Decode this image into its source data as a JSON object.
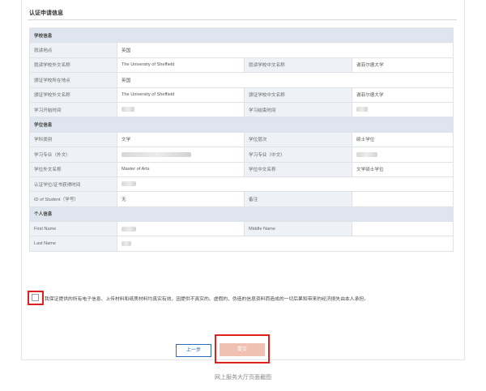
{
  "section_title": "认证申请信息",
  "school_section": {
    "header": "学校信息",
    "rows": [
      {
        "l1": "就读地点",
        "v1": "英国",
        "l2": "",
        "v2": ""
      },
      {
        "l1": "就读学校外文名称",
        "v1": "The University of Sheffield",
        "l2": "就读学校中文名称",
        "v2": "谢菲尔德大学"
      },
      {
        "l1": "颁证学校所在地点",
        "v1": "英国",
        "l2": "",
        "v2": ""
      },
      {
        "l1": "颁证学校外文名称",
        "v1": "The University of Sheffield",
        "l2": "颁证学校中文名称",
        "v2": "谢菲尔德大学"
      },
      {
        "l1": "学习开始时间",
        "v1": "",
        "l2": "学习结束时间",
        "v2": ""
      }
    ]
  },
  "degree_section": {
    "header": "学位信息",
    "rows": [
      {
        "l1": "学科类别",
        "v1": "文学",
        "l2": "学位层次",
        "v2": "硕士学位"
      },
      {
        "l1": "学习专业（外文）",
        "v1": "",
        "l2": "学习专业（中文）",
        "v2": ""
      },
      {
        "l1": "学位外文名称",
        "v1": "Master of Arts",
        "l2": "学位中文名称",
        "v2": "文学硕士学位"
      },
      {
        "l1": "认证学位/证书获得时间",
        "v1": "",
        "l2": "",
        "v2": ""
      },
      {
        "l1": "ID of Student（学号）",
        "v1": "无",
        "l2": "备注",
        "v2": ""
      }
    ]
  },
  "personal_section": {
    "header": "个人信息",
    "rows": [
      {
        "l1": "First Name",
        "v1": "",
        "l2": "Middle Name",
        "v2": ""
      },
      {
        "l1": "Last Name",
        "v1": "",
        "l2": "",
        "v2": ""
      }
    ]
  },
  "agreement_text": "我保证提供的所有电子信息、上传材料和纸质材料均真实有效，因提供不真实的、虚假的、伪造的信息资料而造成的一切后果和带来的经济损失由本人承担。",
  "buttons": {
    "prev": "上一步",
    "submit": "提交"
  },
  "caption": "网上服务大厅页面截图",
  "colors": {
    "highlight": "#e0201b",
    "primary": "#2e6bb8",
    "submit_disabled": "#f0c1b2"
  }
}
